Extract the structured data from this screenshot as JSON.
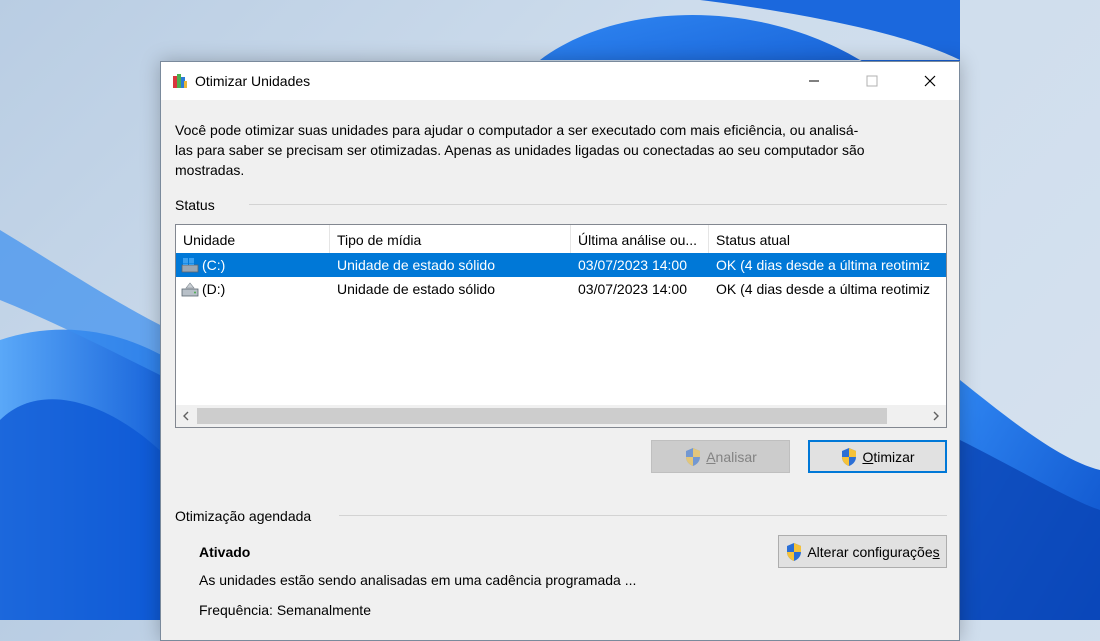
{
  "window": {
    "title": "Otimizar Unidades",
    "app_icon": "defrag-icon",
    "controls": {
      "minimize_icon": "minimize-icon",
      "maximize_icon": "maximize-icon",
      "close_icon": "close-icon"
    }
  },
  "intro_text": "Você pode otimizar suas unidades para ajudar o computador a ser executado com mais eficiência, ou analisá-las para saber se precisam ser otimizadas. Apenas as unidades ligadas ou conectadas ao seu computador são mostradas.",
  "status": {
    "group_label": "Status",
    "columns": [
      "Unidade",
      "Tipo de mídia",
      "Última análise ou...",
      "Status atual"
    ],
    "rows": [
      {
        "drive": "(C:)",
        "media_type": "Unidade de estado sólido",
        "last_run": "03/07/2023 14:00",
        "status": "OK (4 dias desde a última reotimiz",
        "selected": true,
        "icon": "system-drive-icon"
      },
      {
        "drive": "(D:)",
        "media_type": "Unidade de estado sólido",
        "last_run": "03/07/2023 14:00",
        "status": "OK (4 dias desde a última reotimiz",
        "selected": false,
        "icon": "drive-icon"
      }
    ],
    "scroll_left_icon": "scroll-left-icon",
    "scroll_right_icon": "scroll-right-icon"
  },
  "buttons": {
    "analyze": {
      "mnemonic": "A",
      "rest": "nalisar",
      "enabled": false,
      "icon": "uac-shield-icon"
    },
    "optimize": {
      "mnemonic": "O",
      "rest": "timizar",
      "enabled": true,
      "icon": "uac-shield-icon"
    },
    "change_settings": {
      "label_start": "Alterar configuraçõe",
      "mnemonic": "s",
      "icon": "uac-shield-icon"
    }
  },
  "scheduled": {
    "group_label": "Otimização agendada",
    "state": "Ativado",
    "description": "As unidades estão sendo analisadas em uma cadência programada ...",
    "frequency": "Frequência: Semanalmente"
  },
  "colors": {
    "selection": "#0078d7",
    "dialog_bg": "#f0f0f0",
    "wallpaper_blue": "#1d6fe0"
  }
}
